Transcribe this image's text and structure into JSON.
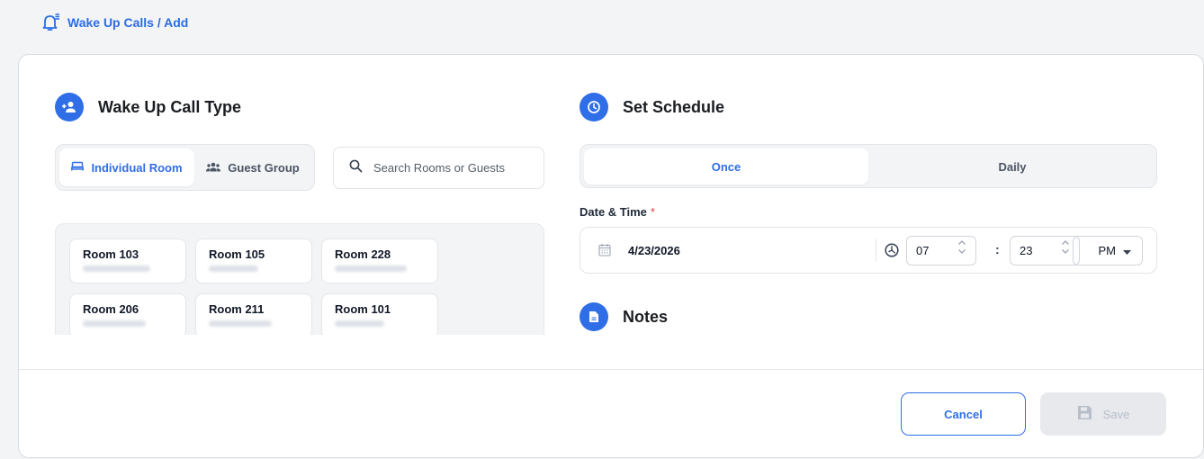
{
  "breadcrumb": {
    "icon": "bell-list-icon",
    "text": "Wake Up Calls / Add"
  },
  "call_type": {
    "title": "Wake Up Call Type",
    "icon": "add-person-icon",
    "tabs": [
      {
        "label": "Individual Room",
        "icon": "bed-icon",
        "active": true
      },
      {
        "label": "Guest Group",
        "icon": "group-icon",
        "active": false
      }
    ],
    "search_placeholder": "Search Rooms or Guests",
    "rooms": [
      {
        "name": "Room 103"
      },
      {
        "name": "Room 105"
      },
      {
        "name": "Room 228"
      },
      {
        "name": "Room 206"
      },
      {
        "name": "Room 211"
      },
      {
        "name": "Room 101"
      }
    ]
  },
  "schedule": {
    "title": "Set Schedule",
    "icon": "clock-icon",
    "tabs": [
      {
        "label": "Once",
        "active": true
      },
      {
        "label": "Daily",
        "active": false
      }
    ],
    "datetime_label": "Date & Time",
    "required_mark": "*",
    "date": "4/23/2026",
    "hour": "07",
    "minute": "23",
    "separator": ":",
    "meridiem": "PM"
  },
  "notes": {
    "title": "Notes",
    "icon": "document-icon"
  },
  "actions": {
    "cancel": "Cancel",
    "save": "Save"
  },
  "colors": {
    "accent": "#2f6ee6",
    "required": "#e23d3d",
    "disabled_bg": "#e7e9ed"
  }
}
